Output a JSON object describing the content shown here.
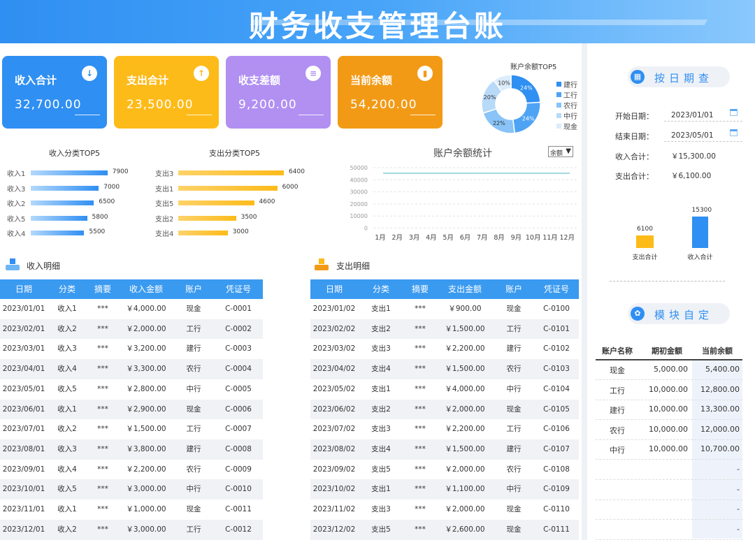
{
  "title": "财务收支管理台账",
  "cards": [
    {
      "label": "收入合计",
      "value": "32,700.00",
      "color": "#2f8ff2",
      "icon": "download-icon",
      "glyph": "↓"
    },
    {
      "label": "支出合计",
      "value": "23,500.00",
      "color": "#fdbb1a",
      "icon": "upload-icon",
      "glyph": "↑"
    },
    {
      "label": "收支差额",
      "value": "9,200.00",
      "color": "#b190f2",
      "icon": "layers-icon",
      "glyph": "≡"
    },
    {
      "label": "当前余额",
      "value": "54,200.00",
      "color": "#f29a16",
      "icon": "bar-chart-icon",
      "glyph": "▮"
    }
  ],
  "pie_chart": {
    "type": "pie",
    "title": "账户余额TOP5",
    "legend": [
      "建行",
      "工行",
      "农行",
      "中行",
      "现金"
    ],
    "labels": [
      "24%",
      "24%",
      "22%",
      "20%",
      "10%"
    ],
    "values": [
      24,
      24,
      22,
      20,
      10
    ],
    "colors": [
      "#2f8ff2",
      "#4ea3f5",
      "#89c3f7",
      "#b8daf9",
      "#dcecfb"
    ]
  },
  "income_top5": {
    "type": "bar",
    "title": "收入分类TOP5",
    "categories": [
      "收入1",
      "收入3",
      "收入2",
      "收入5",
      "收入4"
    ],
    "values": [
      7900,
      7000,
      6500,
      5800,
      5500
    ],
    "value_labels": [
      "7900",
      "7000",
      "6500",
      "5800",
      "5500"
    ],
    "max": 9000
  },
  "expense_top5": {
    "type": "bar",
    "title": "支出分类TOP5",
    "categories": [
      "支出3",
      "支出1",
      "支出5",
      "支出2",
      "支出4"
    ],
    "values": [
      6400,
      6000,
      4600,
      3500,
      3000
    ],
    "value_labels": [
      "6400",
      "6000",
      "4600",
      "3500",
      "3000"
    ],
    "max": 7500
  },
  "balance_chart": {
    "type": "line",
    "title": "账户余额统计",
    "dropdown": "余额",
    "yticks": [
      "50000",
      "40000",
      "30000",
      "20000",
      "10000",
      "0"
    ],
    "months": [
      "1月",
      "2月",
      "3月",
      "4月",
      "5月",
      "6月",
      "7月",
      "8月",
      "9月",
      "10月",
      "11月",
      "12月"
    ]
  },
  "income_section": "收入明细",
  "expense_section": "支出明细",
  "income_headers": [
    "日期",
    "分类",
    "摘要",
    "收入金额",
    "账户",
    "凭证号"
  ],
  "expense_headers": [
    "日期",
    "分类",
    "摘要",
    "支出金额",
    "账户",
    "凭证号"
  ],
  "income_rows": [
    [
      "2023/01/01",
      "收入1",
      "***",
      "￥4,000.00",
      "现金",
      "C-0001"
    ],
    [
      "2023/02/01",
      "收入2",
      "***",
      "￥2,000.00",
      "工行",
      "C-0002"
    ],
    [
      "2023/03/01",
      "收入3",
      "***",
      "￥3,200.00",
      "建行",
      "C-0003"
    ],
    [
      "2023/04/01",
      "收入4",
      "***",
      "￥3,300.00",
      "农行",
      "C-0004"
    ],
    [
      "2023/05/01",
      "收入5",
      "***",
      "￥2,800.00",
      "中行",
      "C-0005"
    ],
    [
      "2023/06/01",
      "收入1",
      "***",
      "￥2,900.00",
      "现金",
      "C-0006"
    ],
    [
      "2023/07/01",
      "收入2",
      "***",
      "￥1,500.00",
      "工行",
      "C-0007"
    ],
    [
      "2023/08/01",
      "收入3",
      "***",
      "￥3,800.00",
      "建行",
      "C-0008"
    ],
    [
      "2023/09/01",
      "收入4",
      "***",
      "￥2,200.00",
      "农行",
      "C-0009"
    ],
    [
      "2023/10/01",
      "收入5",
      "***",
      "￥3,000.00",
      "中行",
      "C-0010"
    ],
    [
      "2023/11/01",
      "收入1",
      "***",
      "￥1,000.00",
      "现金",
      "C-0011"
    ],
    [
      "2023/12/01",
      "收入2",
      "***",
      "￥3,000.00",
      "工行",
      "C-0012"
    ]
  ],
  "expense_rows": [
    [
      "2023/01/02",
      "支出1",
      "***",
      "￥900.00",
      "现金",
      "C-0100"
    ],
    [
      "2023/02/02",
      "支出2",
      "***",
      "￥1,500.00",
      "工行",
      "C-0101"
    ],
    [
      "2023/03/02",
      "支出3",
      "***",
      "￥2,200.00",
      "建行",
      "C-0102"
    ],
    [
      "2023/04/02",
      "支出4",
      "***",
      "￥1,500.00",
      "农行",
      "C-0103"
    ],
    [
      "2023/05/02",
      "支出1",
      "***",
      "￥4,000.00",
      "中行",
      "C-0104"
    ],
    [
      "2023/06/02",
      "支出2",
      "***",
      "￥2,000.00",
      "现金",
      "C-0105"
    ],
    [
      "2023/07/02",
      "支出3",
      "***",
      "￥2,200.00",
      "工行",
      "C-0106"
    ],
    [
      "2023/08/02",
      "支出4",
      "***",
      "￥1,500.00",
      "建行",
      "C-0107"
    ],
    [
      "2023/09/02",
      "支出5",
      "***",
      "￥2,000.00",
      "农行",
      "C-0108"
    ],
    [
      "2023/10/02",
      "支出1",
      "***",
      "￥1,100.00",
      "中行",
      "C-0109"
    ],
    [
      "2023/11/02",
      "支出3",
      "***",
      "￥2,000.00",
      "现金",
      "C-0110"
    ],
    [
      "2023/12/02",
      "支出5",
      "***",
      "￥2,600.00",
      "现金",
      "C-0111"
    ]
  ],
  "date_query": {
    "title": "按日期查",
    "start_label": "开始日期：",
    "start_value": "2023/01/01",
    "end_label": "结束日期：",
    "end_value": "2023/05/01",
    "income_label": "收入合计：",
    "income_value": "￥15,300.00",
    "expense_label": "支出合计：",
    "expense_value": "￥6,100.00"
  },
  "mini_chart": {
    "type": "bar",
    "categories": [
      "支出合计",
      "收入合计"
    ],
    "values": [
      6100,
      15300
    ],
    "value_labels": [
      "6100",
      "15300"
    ],
    "colors": [
      "#fdbb1a",
      "#2f8ff2"
    ],
    "max": 15300
  },
  "module": {
    "title": "模块自定",
    "headers": [
      "账户名称",
      "期初金额",
      "当前余额"
    ],
    "rows": [
      [
        "现金",
        "5,000.00",
        "5,400.00"
      ],
      [
        "工行",
        "10,000.00",
        "12,800.00"
      ],
      [
        "建行",
        "10,000.00",
        "13,300.00"
      ],
      [
        "农行",
        "10,000.00",
        "12,000.00"
      ],
      [
        "中行",
        "10,000.00",
        "10,700.00"
      ],
      [
        "",
        "",
        "-"
      ],
      [
        "",
        "",
        "-"
      ],
      [
        "",
        "",
        "-"
      ],
      [
        "",
        "",
        "-"
      ]
    ]
  }
}
